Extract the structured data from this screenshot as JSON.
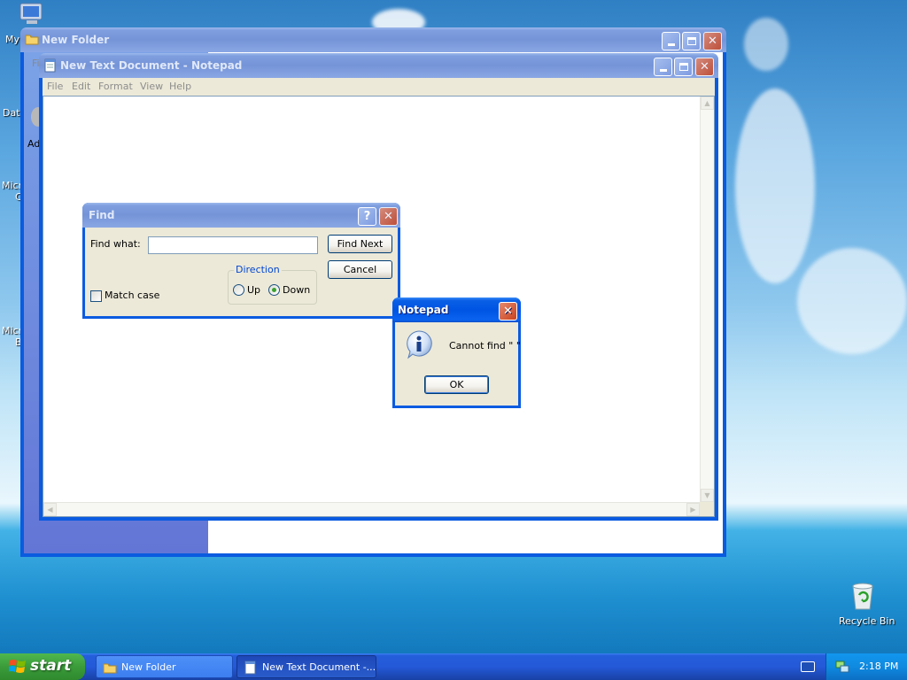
{
  "desktop": {
    "icons": [
      {
        "label": "My",
        "icon": "my-computer-icon"
      },
      {
        "label": "Dat",
        "icon": "file-icon"
      },
      {
        "label": "Micr",
        "sub": "C",
        "icon": "app-icon"
      },
      {
        "label": "Micr",
        "sub": "B",
        "icon": "app-icon"
      },
      {
        "label": "Recycle Bin",
        "icon": "recycle-bin-icon"
      }
    ]
  },
  "explorer": {
    "title": "New Folder",
    "menu_fragment": "Fi",
    "address_fragment": "Ad"
  },
  "notepad": {
    "title": "New Text Document - Notepad",
    "menu": [
      "File",
      "Edit",
      "Format",
      "View",
      "Help"
    ]
  },
  "find_dialog": {
    "title": "Find",
    "find_what_label": "Find what:",
    "find_what_value": "",
    "find_next_label": "Find Next",
    "cancel_label": "Cancel",
    "direction_label": "Direction",
    "up_label": "Up",
    "down_label": "Down",
    "direction_selected": "Down",
    "match_case_label": "Match case",
    "match_case_checked": false
  },
  "message_box": {
    "title": "Notepad",
    "message": "Cannot find \" \"",
    "ok_label": "OK"
  },
  "taskbar": {
    "start_label": "start",
    "tasks": [
      {
        "label": "New Folder",
        "icon": "folder-icon"
      },
      {
        "label": "New Text Document -...",
        "icon": "notepad-icon"
      }
    ],
    "clock": "2:18 PM"
  },
  "colors": {
    "xp_blue": "#0054e3",
    "start_green": "#3b9b3a",
    "close_red": "#c8421e",
    "dialog_face": "#ece9d8"
  }
}
